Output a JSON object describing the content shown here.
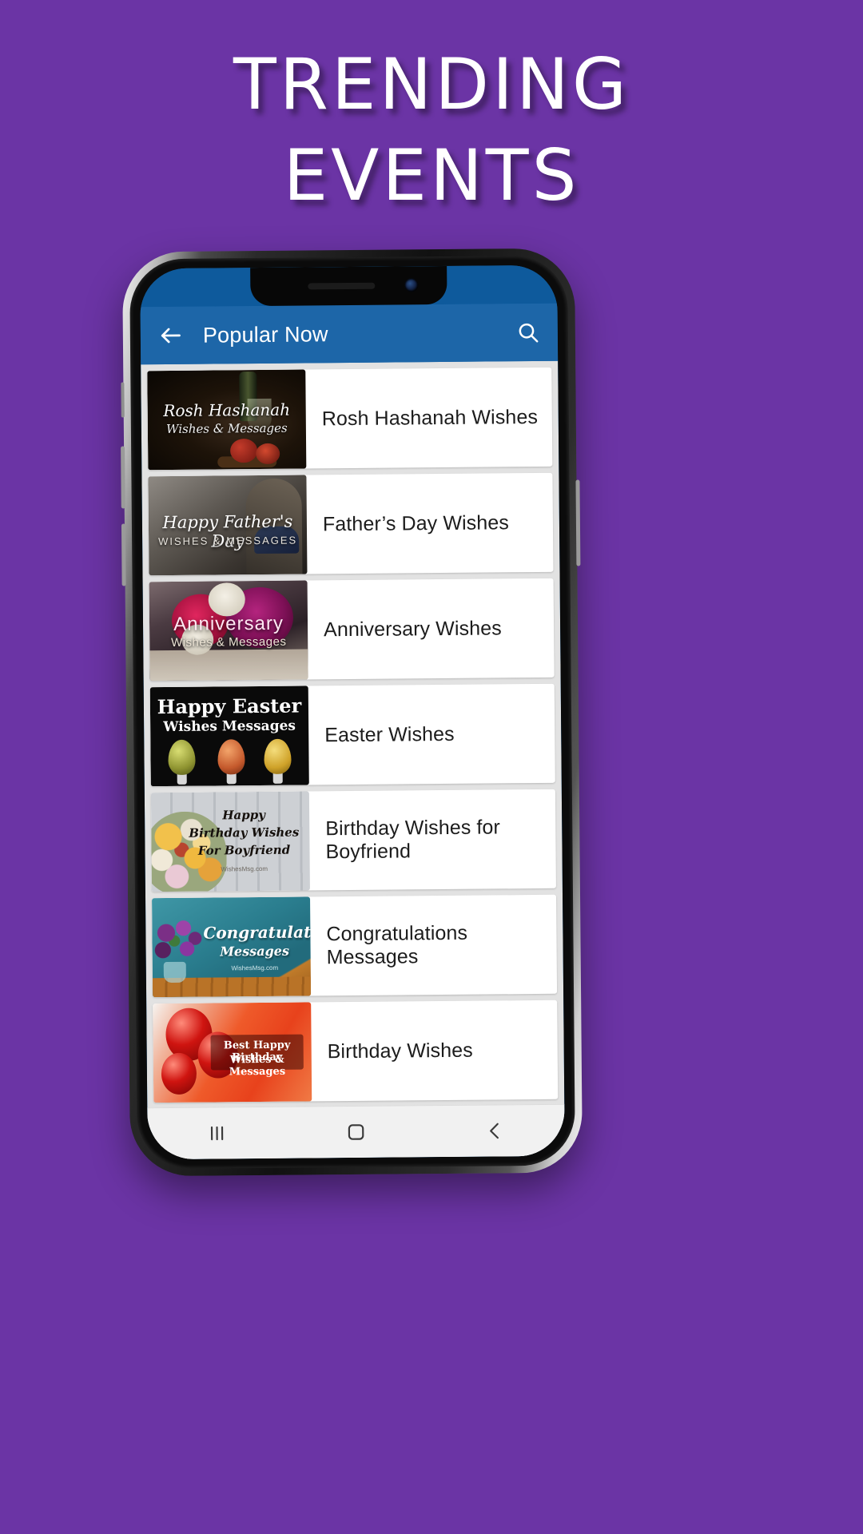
{
  "promo": {
    "line1": "TRENDING",
    "line2": "EVENTS",
    "background_color": "#6b34a5",
    "text_color": "#ffffff"
  },
  "app": {
    "statusbar_color": "#0e5a9c",
    "appbar_color": "#1d66a8",
    "title": "Popular Now",
    "back_icon": "arrow-left-icon",
    "search_icon": "search-icon",
    "list_background": "#e2e2e2"
  },
  "list": {
    "items": [
      {
        "label": "Rosh Hashanah Wishes",
        "thumb_line1": "Rosh Hashanah",
        "thumb_line2": "Wishes & Messages"
      },
      {
        "label": "Father’s Day Wishes",
        "thumb_line1": "Happy Father's Day",
        "thumb_line2": "WISHES & MESSAGES"
      },
      {
        "label": "Anniversary Wishes",
        "thumb_line1": "Anniversary",
        "thumb_line2": "Wishes & Messages"
      },
      {
        "label": "Easter Wishes",
        "thumb_line1": "Happy Easter",
        "thumb_line2": "Wishes Messages"
      },
      {
        "label": "Birthday Wishes for Boyfriend",
        "thumb_line1": "Happy",
        "thumb_line2": "Birthday Wishes",
        "thumb_line3": "For Boyfriend",
        "thumb_watermark": "WishesMsg.com"
      },
      {
        "label": "Congratulations Messages",
        "thumb_line1": "Congratulations",
        "thumb_line2": "Messages",
        "thumb_watermark": "WishesMsg.com"
      },
      {
        "label": "Birthday Wishes",
        "thumb_line1": "Best Happy Birthday",
        "thumb_line2": "Wishes & Messages"
      }
    ]
  },
  "navbar": {
    "recents_icon": "recents-icon",
    "home_icon": "home-icon",
    "back_icon": "back-chevron-icon"
  }
}
